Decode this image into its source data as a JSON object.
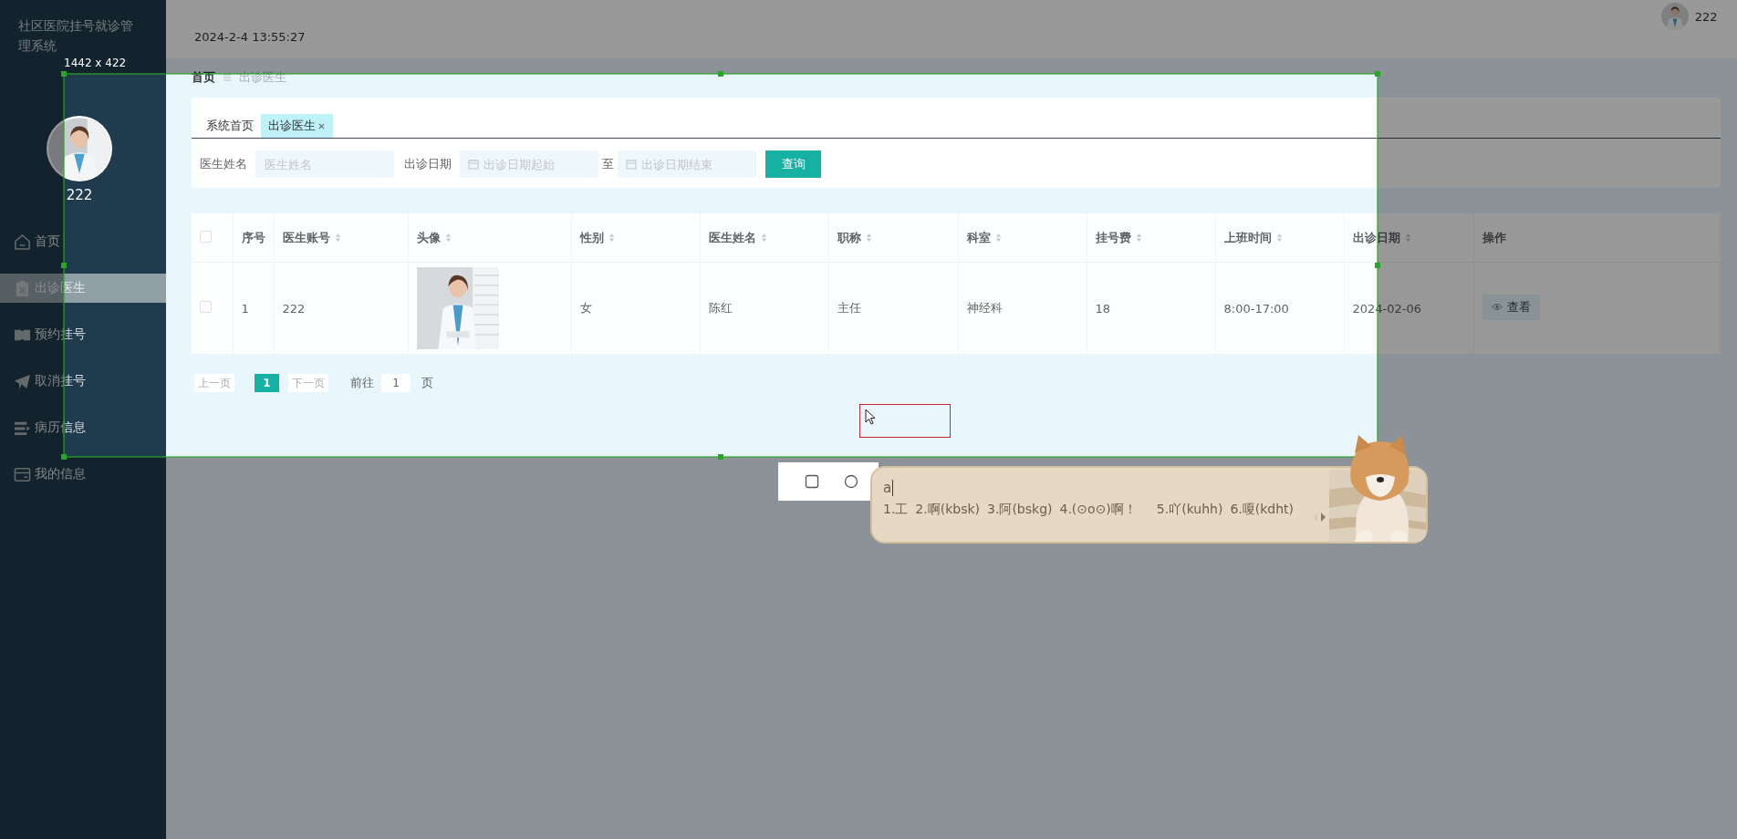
{
  "sidebar": {
    "title": "社区医院挂号就诊管理系统",
    "user": {
      "name": "222",
      "avatar": {
        "kind": "picture"
      }
    },
    "items": [
      {
        "label": "首页",
        "selected": false
      },
      {
        "label": "出诊医生",
        "selected": true
      },
      {
        "label": "预约挂号",
        "selected": false
      },
      {
        "label": "取消挂号",
        "selected": false
      },
      {
        "label": "病历信息",
        "selected": false
      },
      {
        "label": "我的信息",
        "selected": false
      }
    ]
  },
  "header": {
    "datetime": "2024-2-4 13:55:27",
    "user": {
      "name": "222",
      "avatar": {
        "kind": "picture"
      }
    }
  },
  "breadcrumb": [
    "首页",
    "出诊医生"
  ],
  "tabs": [
    {
      "label": "系统首页",
      "selected": false,
      "closable": false
    },
    {
      "label": "出诊医生",
      "selected": true,
      "closable": true
    }
  ],
  "search": {
    "name_label": "医生姓名",
    "name_placeholder": "医生姓名",
    "date_label": "出诊日期",
    "date_start_placeholder": "出诊日期起始",
    "range_separator": "至",
    "date_end_placeholder": "出诊日期结束",
    "button": "查询"
  },
  "table": {
    "all_checked": false,
    "columns": [
      {
        "label": "序号",
        "sortable": false
      },
      {
        "label": "医生账号",
        "sortable": true
      },
      {
        "label": "头像",
        "sortable": true
      },
      {
        "label": "性别",
        "sortable": true
      },
      {
        "label": "医生姓名",
        "sortable": true
      },
      {
        "label": "职称",
        "sortable": true
      },
      {
        "label": "科室",
        "sortable": true
      },
      {
        "label": "挂号费",
        "sortable": true
      },
      {
        "label": "上班时间",
        "sortable": true
      },
      {
        "label": "出诊日期",
        "sortable": true
      },
      {
        "label": "操作",
        "sortable": false
      }
    ],
    "rows": [
      {
        "checked": false,
        "cells": [
          {
            "kind": "text",
            "text": "1"
          },
          {
            "kind": "text",
            "text": "222"
          },
          {
            "kind": "picture"
          },
          {
            "kind": "text",
            "text": "女"
          },
          {
            "kind": "text",
            "text": "陈红"
          },
          {
            "kind": "text",
            "text": "主任"
          },
          {
            "kind": "text",
            "text": "神经科"
          },
          {
            "kind": "text",
            "text": "18"
          },
          {
            "kind": "text",
            "text": "8:00-17:00"
          },
          {
            "kind": "text",
            "text": "2024-02-06"
          },
          {
            "kind": "action",
            "text": "查看"
          }
        ]
      }
    ]
  },
  "pagination": {
    "prev": "上一页",
    "next": "下一页",
    "pages": [
      {
        "label": "1",
        "selected": true
      }
    ],
    "goto_label": "前往",
    "goto_value": "1",
    "goto_suffix": "页"
  },
  "capture": {
    "size_label": "1442 x 422"
  },
  "ime": {
    "input": "a",
    "candidates": [
      "1.工",
      "2.啊(kbsk)",
      "3.阿(bskg)",
      "4.(⊙o⊙)啊！",
      "5.吖(kuhh)",
      "6.嗄(kdht)"
    ]
  }
}
